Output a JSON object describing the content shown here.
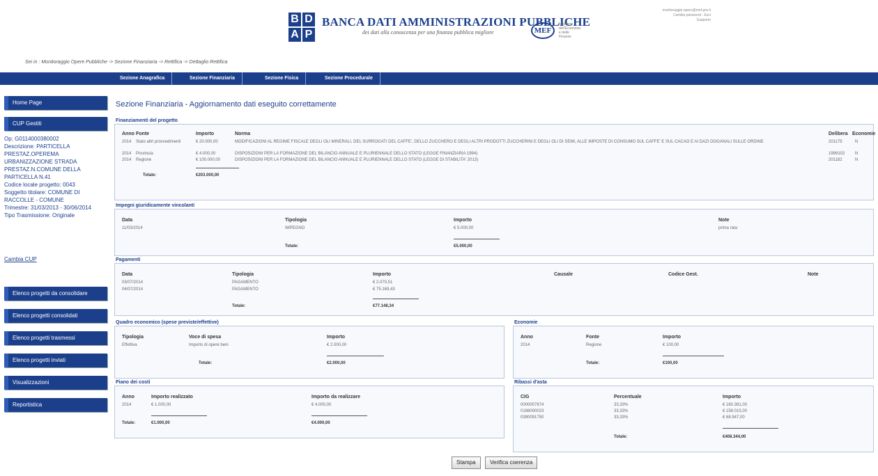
{
  "header": {
    "logo_letters": [
      "B",
      "D",
      "A",
      "P"
    ],
    "title": "BANCA DATI AMMINISTRAZIONI PUBBLICHE",
    "subtitle": "dei dati alla conoscenza per una finanza pubblica migliore",
    "mef_logo": "MEF",
    "mef_text": "Ministero dell'Economia e delle Finanze",
    "user_info": [
      "monitoraggio.opere@mef.gov.it",
      "Cambia password - Esci",
      "Supporto"
    ],
    "brand_color": "#1c3f8c"
  },
  "breadcrumb": "Sei in : Monitoraggio Opere Pubbliche -> Sezione Finanziaria -> Rettifica -> Dettaglio Rettifica",
  "nav": {
    "tabs": [
      "Sezione Anagrafica",
      "Sezione Finanziaria",
      "Sezione Fisica",
      "Sezione Procedurale"
    ]
  },
  "sidebar": {
    "home": "Home Page",
    "cup": "CUP Gestiti",
    "info_lines": [
      "Op: G0114000380002",
      "Descrizione: PARTICELLA",
      "PRESTAZ.OPEREMA",
      "URBANIZZAZIONE STRADA",
      "PRESTAZ.N.COMUNE DELLA",
      "PARTICELLA N.41",
      "Codice locale progetto: 0043",
      "Soggetto titolare: COMUNE DI",
      "RACCOLLE - COMUNE",
      "Trimestre: 31/03/2013 - 30/06/2014",
      "Tipo Trasmissione: Originale"
    ],
    "link": "Cambia CUP",
    "menu": [
      "Elenco progetti da consolidare",
      "Elenco progetti consolidati",
      "Elenco progetti trasmessi",
      "Elenco progetti inviati",
      "Visualizzazioni",
      "Reportistica"
    ]
  },
  "main": {
    "title": "Sezione Finanziaria - Aggiornamento dati eseguito correttamente",
    "finanziamenti": {
      "legend": "Finanziamenti del progetto",
      "headers": [
        "Anno",
        "Fonte",
        "Importo",
        "Norma",
        "Delibera",
        "Economie"
      ],
      "rows": [
        {
          "anno": "2014",
          "fonte": "Stato altri provvedimenti",
          "importo": "€ 20.000,00",
          "norma": "MODIFICAZIONI AL REGIME FISCALE DEGLI OLI MINERALI, DEL SURROGATI DEL CAFFE', DELLO ZUCCHERO E DEGLI ALTRI PRODOTTI ZUCCHERINI E DEGLI OLI DI SEMI, ALLE IMPOSTE DI CONSUMO SUL CAFFE' E SUL CACAO E AI DAZI DOGANALI SULLE ORDINE",
          "delibera": "201175",
          "economie": "N"
        },
        {
          "anno": "2014",
          "fonte": "Provincia",
          "importo": "€ 4.000,00",
          "norma": "DISPOSIZIONI PER LA FORMAZIONE DEL BILANCIO ANNUALE E PLURIENNALE DELLO STATO (LEGGE FINANZIARIA 1994)",
          "delibera": "1999102",
          "economie": "N"
        },
        {
          "anno": "2014",
          "fonte": "Regione",
          "importo": "€ 100.000,00",
          "norma": "DISPOSIZIONI PER LA FORMAZIONE DEL BILANCIO ANNUALE E PLURIENNALE DELLO STATO (LEGGE DI STABILITA' 2013)",
          "delibera": "201182",
          "economie": "N"
        }
      ],
      "total_label": "Totale:",
      "total": "€203.000,00"
    },
    "impegni": {
      "legend": "Impegni giuridicamente vincolanti",
      "headers": [
        "Data",
        "Tipologia",
        "Importo",
        "Note"
      ],
      "rows": [
        {
          "data": "11/03/2014",
          "tipologia": "IMPEGNO",
          "importo": "€ 5.000,00",
          "note": "prima rata"
        }
      ],
      "total_label": "Totale:",
      "total": "€5.000,00"
    },
    "pagamenti": {
      "legend": "Pagamenti",
      "headers": [
        "Data",
        "Tipologia",
        "Importo",
        "Causale",
        "Codice Gest.",
        "Note"
      ],
      "rows": [
        {
          "data": "03/07/2014",
          "tipologia": "PAGAMENTO",
          "importo": "€ 2.070,51"
        },
        {
          "data": "04/07/2014",
          "tipologia": "PAGAMENTO",
          "importo": "€ 75.169,43"
        }
      ],
      "total_label": "Totale:",
      "total": "€77.148,34"
    },
    "quadro": {
      "legend": "Quadro economico (spese previste/effettive)",
      "headers": [
        "Tipologia",
        "Voce di spesa",
        "Importo"
      ],
      "rows": [
        {
          "tipologia": "Effettiva",
          "voce": "Importo di opere beni",
          "importo": "€ 2.000,00"
        }
      ],
      "total_label": "Totale:",
      "total": "€2.000,00"
    },
    "economie": {
      "legend": "Economie",
      "headers": [
        "Anno",
        "Fonte",
        "Importo"
      ],
      "rows": [
        {
          "anno": "2014",
          "fonte": "Regione",
          "importo": "€ 100,00"
        }
      ],
      "total_label": "Totale:",
      "total": "€100,00"
    },
    "piano": {
      "legend": "Piano dei costi",
      "headers": [
        "Anno",
        "Importo realizzato",
        "Importo da realizzare"
      ],
      "rows": [
        {
          "anno": "2014",
          "realizzato": "€ 1.000,00",
          "da_realizzare": "€ 4.000,00"
        }
      ],
      "total_label": "Totale:",
      "total_realizzato": "€1.000,00",
      "total_da_realizzare": "€4.000,00"
    },
    "ribassi": {
      "legend": "Ribassi d'asta",
      "headers": [
        "CIG",
        "Percentuale",
        "Importo"
      ],
      "rows": [
        {
          "cig": "0000007874",
          "perc": "33,33%",
          "importo": "€ 160.381,00"
        },
        {
          "cig": "0188000023",
          "perc": "33,33%",
          "importo": "€ 158.015,00"
        },
        {
          "cig": "0390091750",
          "perc": "33,33%",
          "importo": "€ 68.947,00"
        }
      ],
      "total_label": "Totale:",
      "total": "€408.344,00"
    }
  },
  "buttons": {
    "stampa": "Stampa",
    "verifica": "Verifica coerenza"
  }
}
